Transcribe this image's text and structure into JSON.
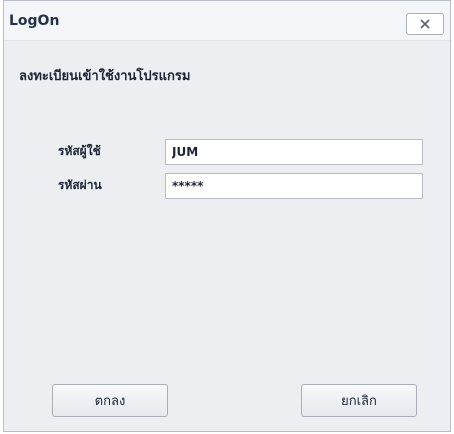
{
  "window": {
    "title": "LogOn"
  },
  "form": {
    "heading": "ลงทะเบียนเข้าใช้งานโปรแกรม",
    "username_label": "รหัสผู้ใช้",
    "username_value": "JUM",
    "password_label": "รหัสผ่าน",
    "password_value": "*****"
  },
  "buttons": {
    "ok_label": "ตกลง",
    "cancel_label": "ยกเลิก"
  },
  "icons": {
    "close": "close-icon"
  }
}
